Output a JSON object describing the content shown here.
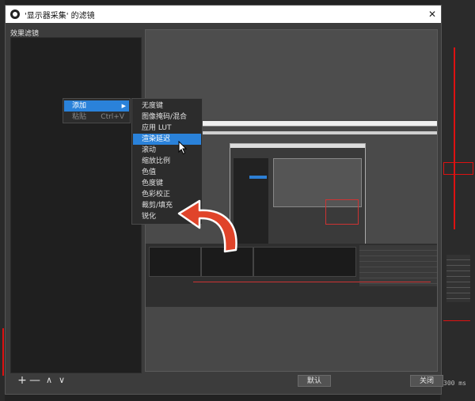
{
  "dialog": {
    "title": "'显示器采集' 的滤镜",
    "close_glyph": "✕",
    "panel_label": "效果滤镜"
  },
  "context_menu": {
    "items": [
      {
        "label": "添加",
        "state": "active",
        "submenu": true
      },
      {
        "label": "粘贴",
        "state": "disabled",
        "shortcut": "Ctrl+V"
      }
    ]
  },
  "submenu": {
    "items": [
      {
        "label": "无度键"
      },
      {
        "label": "图像掩码/混合"
      },
      {
        "label": "应用 LUT"
      },
      {
        "label": "渲染延迟",
        "highlighted": true
      },
      {
        "label": "滚动"
      },
      {
        "label": "缩放比例"
      },
      {
        "label": "色值"
      },
      {
        "label": "色度键"
      },
      {
        "label": "色彩校正"
      },
      {
        "label": "裁剪/填充"
      },
      {
        "label": "锐化"
      }
    ]
  },
  "bottom": {
    "add_glyph": "+",
    "remove_glyph": "—",
    "up_glyph": "∧",
    "down_glyph": "∨",
    "default_label": "默认",
    "close_label": "关闭"
  },
  "background_app": {
    "readout": "300 ms"
  },
  "colors": {
    "accent": "#2a82da",
    "annotation_arrow": "#e0442a"
  }
}
